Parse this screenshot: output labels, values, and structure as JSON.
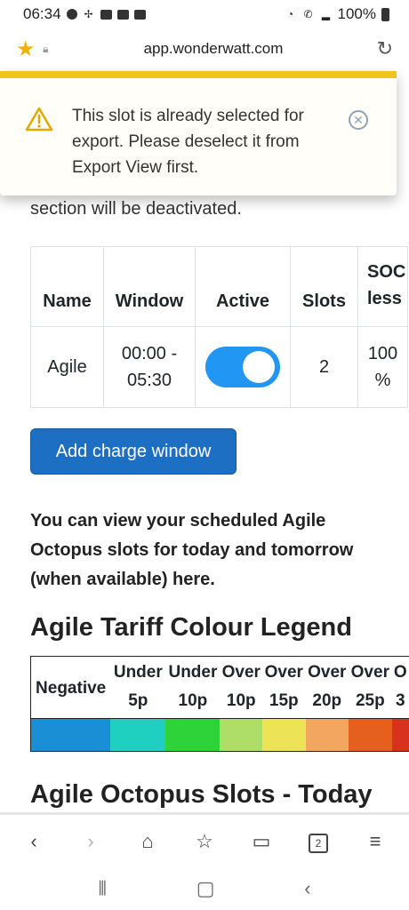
{
  "status_bar": {
    "time": "06:34",
    "battery": "100%"
  },
  "address_bar": {
    "url": "app.wonderwatt.com"
  },
  "toast": {
    "message": "This slot is already selected for export. Please deselect it from Export View first."
  },
  "page": {
    "partial_text": "section will be deactivated.",
    "table": {
      "headers": [
        "Name",
        "Window",
        "Active",
        "Slots",
        "SOC less"
      ],
      "row": {
        "name": "Agile",
        "window": "00:00 - 05:30",
        "active": true,
        "slots": "2",
        "soc": "100 %"
      }
    },
    "add_button": "Add charge window",
    "info_text": "You can view your scheduled Agile Octopus slots for today and tomorrow (when available) here.",
    "legend_title": "Agile Tariff Colour Legend",
    "legend": [
      {
        "label": "Negative",
        "color": "#1b8fd6"
      },
      {
        "label": "Under 5p",
        "color": "#1fd0c0"
      },
      {
        "label": "Under 10p",
        "color": "#2ed33a"
      },
      {
        "label": "Over 10p",
        "color": "#aede68"
      },
      {
        "label": "Over 15p",
        "color": "#ece356"
      },
      {
        "label": "Over 20p",
        "color": "#f2a65f"
      },
      {
        "label": "Over 25p",
        "color": "#e5601e"
      },
      {
        "label": "O 3",
        "color": "#d8321f"
      }
    ],
    "slots_title": "Agile Octopus Slots - Today"
  },
  "bottom_nav": {
    "tab_count": "2"
  }
}
